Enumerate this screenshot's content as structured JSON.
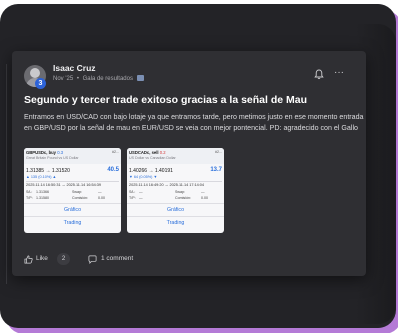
{
  "post": {
    "author": "Isaac Cruz",
    "level": "3",
    "date": "Nov '25",
    "separator": "•",
    "forum": "Gala de resultados",
    "title": "Segundo y tercer trade exitoso gracias a la señal de Mau",
    "body": "Entramos en USD/CAD con bajo lotaje ya que entramos tarde, pero metimos justo en ese momento entrada en GBP/USD por la señal de mau en EUR/USD se veia con mejor pontencial. PD: agradecido con el Gallo"
  },
  "icons": {
    "avatar": "user-avatar-icon",
    "bell": "bell-icon",
    "more": "more-horizontal-icon",
    "like": "thumbs-up-icon",
    "comment": "comment-bubble-icon",
    "forum": "gallery-icon"
  },
  "screenshots": [
    {
      "symbol": "GBPUSDc, buy",
      "change": "0.3",
      "description": "Great Britain Pound vs US Dollar",
      "corner": "#2...",
      "price": "1.31385 → 1.31520",
      "profit": "40.5",
      "pct": "▲ 135 (0.10%) ▲",
      "dates": "2025.11.14 16:50:31 → 2025.11.14 16:54:39",
      "rows": [
        {
          "a": "S/L:",
          "b": "1.31366",
          "c": "Swap:",
          "d": "—"
        },
        {
          "a": "T/P:",
          "b": "1.31580",
          "c": "Comisión:",
          "d": "0.00"
        }
      ],
      "chart_button": "Gráfico",
      "trading_button": "Trading",
      "change_color": "#2a6fdb"
    },
    {
      "symbol": "USDCADc, sell",
      "change": "0.2",
      "description": "US Dollar vs Canadian Dollar",
      "corner": "#2...",
      "price": "1.40266 → 1.40191",
      "profit": "13.7",
      "pct": "▼ 64 (0.05%) ▼",
      "dates": "2025.11.14 16:49:20 → 2025.11.14 17:14:04",
      "rows": [
        {
          "a": "S/L:",
          "b": "—",
          "c": "Swap:",
          "d": "—"
        },
        {
          "a": "T/P:",
          "b": "—",
          "c": "Comisión:",
          "d": "0.00"
        }
      ],
      "chart_button": "Gráfico",
      "trading_button": "Trading",
      "change_color": "#d43c3c"
    }
  ],
  "actions": {
    "like_label": "Like",
    "like_count": "2",
    "comment_label": "1 comment"
  },
  "colors": {
    "device_bg": "#232327",
    "card_bg": "#2f2f33",
    "accent_shadow": "#b47ad6",
    "badge": "#2d63d8",
    "link_blue": "#2a6fdb"
  }
}
